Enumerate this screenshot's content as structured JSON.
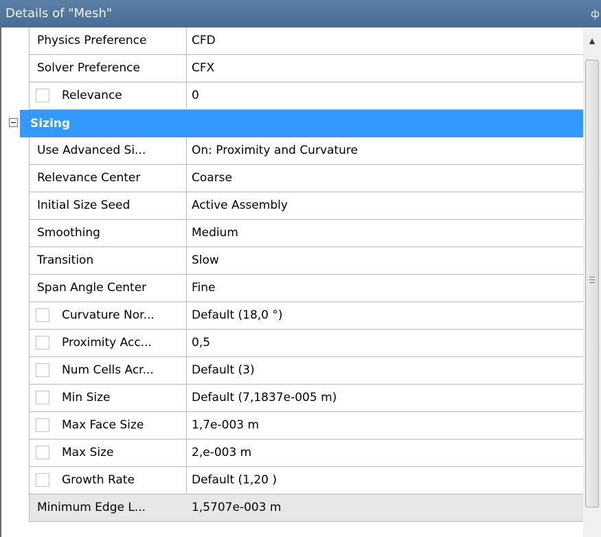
{
  "window": {
    "title": "Details of \"Mesh\"",
    "pin_glyph": "ф"
  },
  "rows_before": [
    {
      "name": "Physics Preference",
      "value": "CFD",
      "checkbox": false
    },
    {
      "name": "Solver Preference",
      "value": "CFX",
      "checkbox": false
    },
    {
      "name": "Relevance",
      "value": "0",
      "checkbox": true
    }
  ],
  "group": {
    "label": "Sizing",
    "expanded": true
  },
  "rows_after": [
    {
      "name": "Use Advanced Si...",
      "value": "On: Proximity and Curvature",
      "checkbox": false
    },
    {
      "name": "Relevance Center",
      "value": "Coarse",
      "checkbox": false
    },
    {
      "name": "Initial Size Seed",
      "value": "Active Assembly",
      "checkbox": false
    },
    {
      "name": "Smoothing",
      "value": "Medium",
      "checkbox": false
    },
    {
      "name": "Transition",
      "value": "Slow",
      "checkbox": false
    },
    {
      "name": "Span Angle Center",
      "value": "Fine",
      "checkbox": false
    },
    {
      "name": "Curvature Nor...",
      "value": "Default (18,0 °)",
      "checkbox": true
    },
    {
      "name": "Proximity Acc...",
      "value": "0,5",
      "checkbox": true
    },
    {
      "name": "Num Cells Acr...",
      "value": "Default (3)",
      "checkbox": true
    },
    {
      "name": "Min Size",
      "value": "Default (7,1837e-005 m)",
      "checkbox": true
    },
    {
      "name": "Max Face Size",
      "value": "1,7e-003 m",
      "checkbox": true
    },
    {
      "name": "Max Size",
      "value": "2,e-003 m",
      "checkbox": true
    },
    {
      "name": "Growth Rate",
      "value": "Default (1,20 )",
      "checkbox": true
    },
    {
      "name": "Minimum Edge L...",
      "value": "1,5707e-003 m",
      "checkbox": false,
      "readonly": true
    }
  ],
  "colors": {
    "title_bar": "#4f7399",
    "selected_group": "#3399ff",
    "readonly_row": "#e6e6e6"
  },
  "icons": {
    "scroll_up": "scroll-up-arrow-icon",
    "grip": "scroll-grip-icon",
    "pin": "pin-icon",
    "collapse": "collapse-minus-icon"
  }
}
